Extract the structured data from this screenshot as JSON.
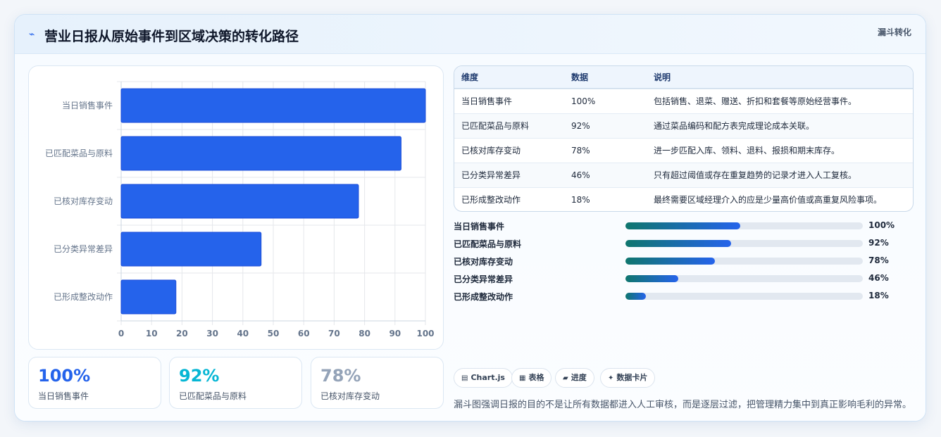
{
  "header": {
    "icon": "wave-icon",
    "title": "营业日报从原始事件到区域决策的转化路径",
    "tag": "漏斗转化"
  },
  "chart_data": {
    "type": "bar",
    "orientation": "horizontal",
    "categories": [
      "当日销售事件",
      "已匹配菜品与原料",
      "已核对库存变动",
      "已分类异常差异",
      "已形成整改动作"
    ],
    "values": [
      100,
      92,
      78,
      46,
      18
    ],
    "xlim": [
      0,
      100
    ],
    "xticks": [
      "0",
      "10",
      "20",
      "30",
      "40",
      "50",
      "60",
      "70",
      "80",
      "90",
      "100"
    ],
    "grid": true,
    "bar_color": "#2563eb"
  },
  "stats": [
    {
      "value": "100%",
      "label": "当日销售事件",
      "color": "#2563eb"
    },
    {
      "value": "92%",
      "label": "已匹配菜品与原料",
      "color": "#06b6d4"
    },
    {
      "value": "78%",
      "label": "已核对库存变动",
      "color": "#94a3b8"
    }
  ],
  "table": {
    "headers": [
      "维度",
      "数据",
      "说明"
    ],
    "rows": [
      [
        "当日销售事件",
        "100%",
        "包括销售、退菜、赠送、折扣和套餐等原始经营事件。"
      ],
      [
        "已匹配菜品与原料",
        "92%",
        "通过菜品编码和配方表完成理论成本关联。"
      ],
      [
        "已核对库存变动",
        "78%",
        "进一步匹配入库、领料、退料、报损和期末库存。"
      ],
      [
        "已分类异常差异",
        "46%",
        "只有超过阈值或存在重复趋势的记录才进入人工复核。"
      ],
      [
        "已形成整改动作",
        "18%",
        "最终需要区域经理介入的应是少量高价值或高重复风险事项。"
      ]
    ]
  },
  "progress": [
    {
      "label": "当日销售事件",
      "value": "100%",
      "fraction": 0.485
    },
    {
      "label": "已匹配菜品与原料",
      "value": "92%",
      "fraction": 0.446
    },
    {
      "label": "已核对库存变动",
      "value": "78%",
      "fraction": 0.378
    },
    {
      "label": "已分类异常差异",
      "value": "46%",
      "fraction": 0.223
    },
    {
      "label": "已形成整改动作",
      "value": "18%",
      "fraction": 0.087
    }
  ],
  "chips": [
    {
      "icon": "▤",
      "label": "Chart.js"
    },
    {
      "icon": "▦",
      "label": "表格"
    },
    {
      "icon": "▰",
      "label": "进度"
    },
    {
      "icon": "✦",
      "label": "数据卡片"
    }
  ],
  "footnote": "漏斗图强调日报的目的不是让所有数据都进入人工审核，而是逐层过滤，把管理精力集中到真正影响毛利的异常。"
}
